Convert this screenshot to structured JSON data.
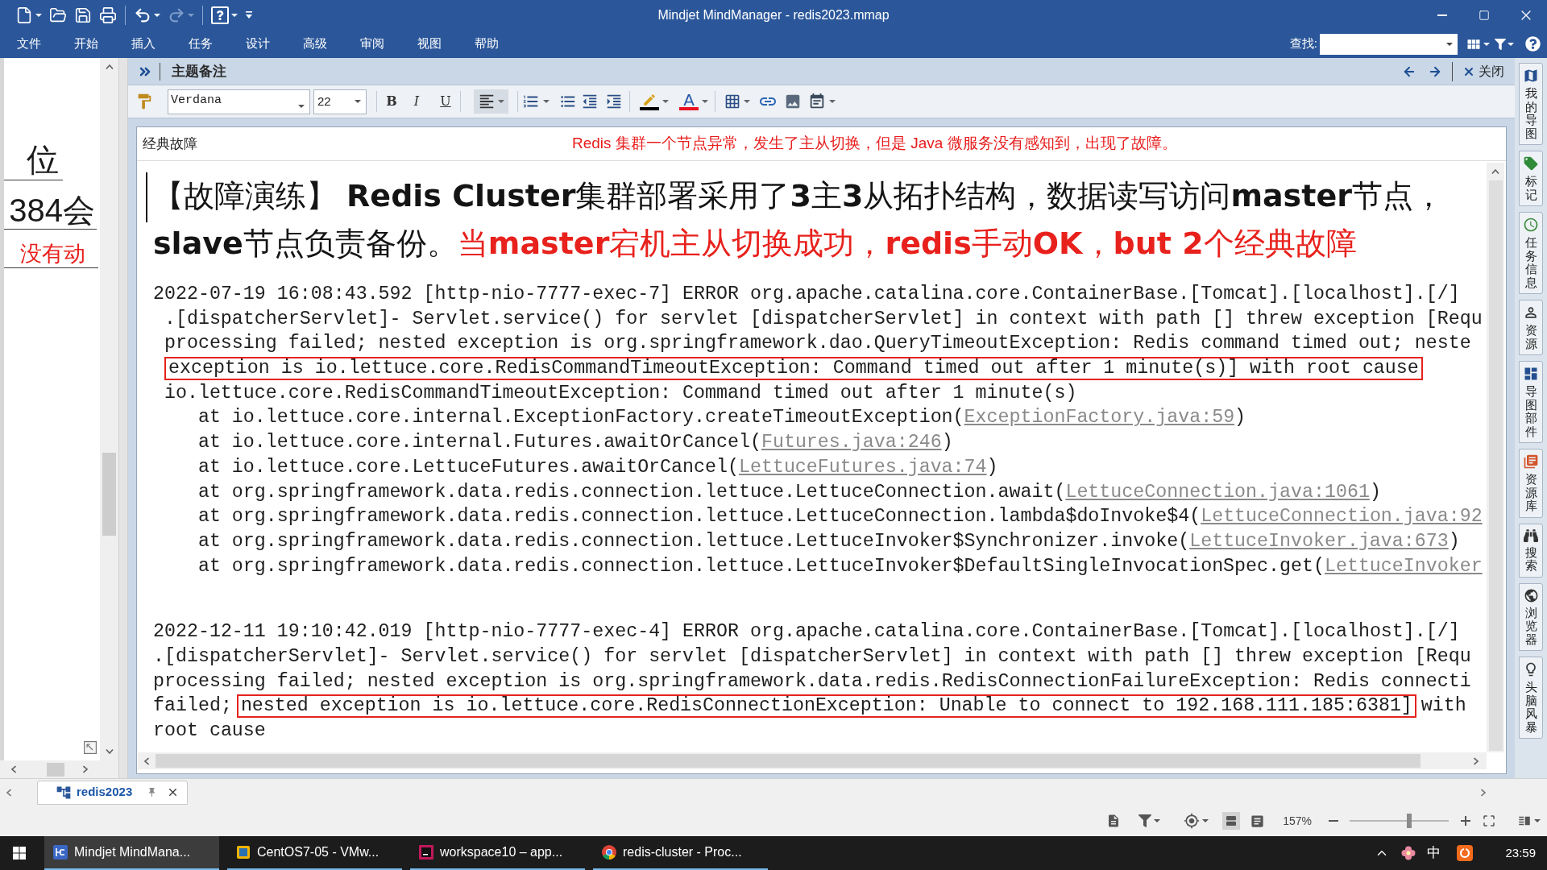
{
  "window": {
    "title": "Mindjet MindManager - redis2023.mmap"
  },
  "quick_access": [
    {
      "kind": "new",
      "disabled": false
    },
    {
      "kind": "open",
      "disabled": false
    },
    {
      "kind": "save",
      "disabled": false
    },
    {
      "kind": "print",
      "disabled": false
    },
    {
      "kind": "undo",
      "disabled": false
    },
    {
      "kind": "redo",
      "disabled": true
    },
    {
      "kind": "help",
      "disabled": false
    },
    {
      "kind": "customize",
      "disabled": false
    }
  ],
  "menu": [
    "文件",
    "开始",
    "插入",
    "任务",
    "设计",
    "高级",
    "审阅",
    "视图",
    "帮助"
  ],
  "search": {
    "label": "查找:"
  },
  "map_panel": {
    "topics": [
      {
        "kind": "plain",
        "text": "位"
      },
      {
        "kind": "plain",
        "text": "384会"
      },
      {
        "kind": "warning",
        "text": "没有动"
      }
    ]
  },
  "notes_panel": {
    "title": "主题备注",
    "close_label": "关闭",
    "toolbar": {
      "font": "Verdana",
      "size": "22",
      "styles": [
        {
          "kind": "bold",
          "label": "B",
          "selected": false
        },
        {
          "kind": "italic",
          "label": "I",
          "selected": false
        },
        {
          "kind": "underline",
          "label": "U",
          "selected": false
        }
      ],
      "align": {
        "selected": true
      },
      "tools": [
        {
          "kind": "numbered-list"
        },
        {
          "kind": "bullet-list"
        },
        {
          "kind": "outdent"
        },
        {
          "kind": "indent"
        },
        {
          "kind": "highlight"
        },
        {
          "kind": "font-color",
          "label": "A"
        },
        {
          "kind": "table"
        },
        {
          "kind": "link"
        },
        {
          "kind": "image"
        },
        {
          "kind": "more"
        }
      ]
    },
    "note": {
      "title": "经典故障",
      "comment": "Redis 集群一个节点异常，发生了主从切换，但是 Java 微服务没有感知到，出现了故障。",
      "heading": [
        [
          {
            "kind": "plain",
            "text": "【故障演练】 **Redis Cluster**集群部署采用了**3**主**3**从拓扑结构，数据读写访问**master**节点，"
          }
        ],
        [
          {
            "kind": "plain",
            "text": "**slave**节点负责备份。"
          },
          {
            "kind": "emphasis",
            "text": "当**master**宕机主从切换成功，**redis**手动**OK**，**but 2**个经典故障"
          }
        ]
      ],
      "log_entries": [
        {
          "lines": [
            {
              "kind": "message",
              "parts": [
                {
                  "kind": "plain",
                  "text": "2022-07-19 16:08:43.592 [http-nio-7777-exec-7] ERROR org.apache.catalina.core.ContainerBase.[Tomcat].[localhost].[/]",
                  "boxed": false
                }
              ]
            },
            {
              "kind": "indented",
              "parts": [
                {
                  "kind": "plain",
                  "text": ".[dispatcherServlet]- Servlet.service() for servlet [dispatcherServlet] in context with path [] threw exception [Requ",
                  "boxed": false
                }
              ]
            },
            {
              "kind": "indented",
              "parts": [
                {
                  "kind": "plain",
                  "text": "processing failed; nested exception is org.springframework.dao.QueryTimeoutException: Redis command timed out; neste",
                  "boxed": false
                }
              ]
            },
            {
              "kind": "indented",
              "parts": [
                {
                  "kind": "plain",
                  "text": "exception is io.lettuce.core.RedisCommandTimeoutException: Command timed out after 1 minute(s)] with root cause",
                  "boxed": true
                }
              ]
            },
            {
              "kind": "indented",
              "parts": [
                {
                  "kind": "plain",
                  "text": "io.lettuce.core.RedisCommandTimeoutException: Command timed out after 1 minute(s)",
                  "boxed": false
                }
              ]
            },
            {
              "kind": "frame",
              "parts": [
                {
                  "kind": "plain",
                  "text": "at io.lettuce.core.internal.ExceptionFactory.createTimeoutException(",
                  "boxed": false
                },
                {
                  "kind": "link",
                  "text": "ExceptionFactory.java:59",
                  "boxed": false
                },
                {
                  "kind": "plain",
                  "text": ")",
                  "boxed": false
                }
              ]
            },
            {
              "kind": "frame",
              "parts": [
                {
                  "kind": "plain",
                  "text": "at io.lettuce.core.internal.Futures.awaitOrCancel(",
                  "boxed": false
                },
                {
                  "kind": "link",
                  "text": "Futures.java:246",
                  "boxed": false
                },
                {
                  "kind": "plain",
                  "text": ")",
                  "boxed": false
                }
              ]
            },
            {
              "kind": "frame",
              "parts": [
                {
                  "kind": "plain",
                  "text": "at io.lettuce.core.LettuceFutures.awaitOrCancel(",
                  "boxed": false
                },
                {
                  "kind": "link",
                  "text": "LettuceFutures.java:74",
                  "boxed": false
                },
                {
                  "kind": "plain",
                  "text": ")",
                  "boxed": false
                }
              ]
            },
            {
              "kind": "frame",
              "parts": [
                {
                  "kind": "plain",
                  "text": "at org.springframework.data.redis.connection.lettuce.LettuceConnection.await(",
                  "boxed": false
                },
                {
                  "kind": "link",
                  "text": "LettuceConnection.java:1061",
                  "boxed": false
                },
                {
                  "kind": "plain",
                  "text": ")",
                  "boxed": false
                }
              ]
            },
            {
              "kind": "frame",
              "parts": [
                {
                  "kind": "plain",
                  "text": "at org.springframework.data.redis.connection.lettuce.LettuceConnection.lambda$doInvoke$4(",
                  "boxed": false
                },
                {
                  "kind": "link",
                  "text": "LettuceConnection.java:92",
                  "boxed": false
                }
              ]
            },
            {
              "kind": "frame",
              "parts": [
                {
                  "kind": "plain",
                  "text": "at org.springframework.data.redis.connection.lettuce.LettuceInvoker$Synchronizer.invoke(",
                  "boxed": false
                },
                {
                  "kind": "link",
                  "text": "LettuceInvoker.java:673",
                  "boxed": false
                },
                {
                  "kind": "plain",
                  "text": ")",
                  "boxed": false
                }
              ]
            },
            {
              "kind": "frame",
              "parts": [
                {
                  "kind": "plain",
                  "text": "at org.springframework.data.redis.connection.lettuce.LettuceInvoker$DefaultSingleInvocationSpec.get(",
                  "boxed": false
                },
                {
                  "kind": "link",
                  "text": "LettuceInvoker",
                  "boxed": false
                }
              ]
            }
          ]
        },
        {
          "lines": [
            {
              "kind": "message",
              "parts": [
                {
                  "kind": "plain",
                  "text": "2022-12-11 19:10:42.019 [http-nio-7777-exec-4] ERROR org.apache.catalina.core.ContainerBase.[Tomcat].[localhost].[/]",
                  "boxed": false
                }
              ]
            },
            {
              "kind": "message",
              "parts": [
                {
                  "kind": "plain",
                  "text": ".[dispatcherServlet]- Servlet.service() for servlet [dispatcherServlet] in context with path [] threw exception [Requ",
                  "boxed": false
                }
              ]
            },
            {
              "kind": "message",
              "parts": [
                {
                  "kind": "plain",
                  "text": "processing failed; nested exception is org.springframework.data.redis.RedisConnectionFailureException: Redis connecti",
                  "boxed": false
                }
              ]
            },
            {
              "kind": "message",
              "parts": [
                {
                  "kind": "plain",
                  "text": "failed;",
                  "boxed": false
                },
                {
                  "kind": "plain",
                  "text": "nested exception is io.lettuce.core.RedisConnectionException: Unable to connect to 192.168.111.185:6381]",
                  "boxed": true
                },
                {
                  "kind": "plain",
                  "text": "with",
                  "boxed": false
                }
              ]
            },
            {
              "kind": "message",
              "parts": [
                {
                  "kind": "plain",
                  "text": "root cause",
                  "boxed": false
                }
              ]
            }
          ]
        }
      ]
    }
  },
  "side_tabs": [
    {
      "kind": "maps",
      "label": "我的导图"
    },
    {
      "kind": "markers",
      "label": "标记"
    },
    {
      "kind": "task-info",
      "label": "任务信息"
    },
    {
      "kind": "resources",
      "label": "资源"
    },
    {
      "kind": "map-parts",
      "label": "导图部件"
    },
    {
      "kind": "library",
      "label": "资源库"
    },
    {
      "kind": "search",
      "label": "搜索"
    },
    {
      "kind": "browser",
      "label": "浏览器"
    },
    {
      "kind": "brainstorm",
      "label": "头脑风暴"
    }
  ],
  "doc_tabs": [
    {
      "label": "redis2023",
      "selected": true
    }
  ],
  "status_bar": {
    "zoom": {
      "label": "157%",
      "level": 0.6
    }
  },
  "taskbar": {
    "apps": [
      {
        "kind": "mindmap",
        "label": "Mindjet MindMana...",
        "selected": true
      },
      {
        "kind": "vm",
        "label": "CentOS7-05 - VMw...",
        "selected": false
      },
      {
        "kind": "ide",
        "label": "workspace10 – app...",
        "selected": false
      },
      {
        "kind": "browser",
        "label": "redis-cluster - Proc...",
        "selected": false
      }
    ],
    "ime": "中",
    "time": "23:59"
  }
}
